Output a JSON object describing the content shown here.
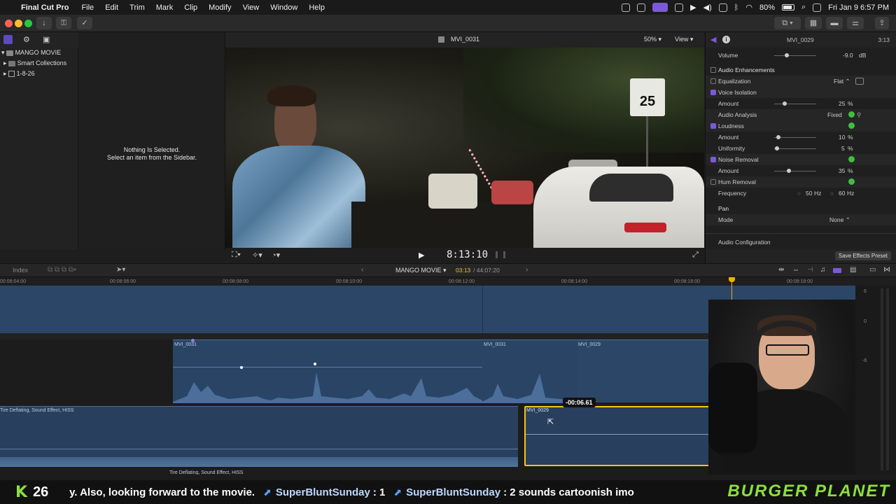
{
  "menubar": {
    "app_name": "Final Cut Pro",
    "items": [
      "File",
      "Edit",
      "Trim",
      "Mark",
      "Clip",
      "Modify",
      "View",
      "Window",
      "Help"
    ],
    "battery": "80%",
    "datetime": "Fri Jan 9  6:57 PM"
  },
  "sidebar": {
    "library": "MANGO MOVIE",
    "items": [
      "Smart Collections",
      "1-8-26"
    ]
  },
  "browser": {
    "empty_line1": "Nothing Is Selected.",
    "empty_line2": "Select an item from the Sidebar."
  },
  "viewer": {
    "clip_name": "MVI_0031",
    "zoom": "50%",
    "view_label": "View",
    "timecode": "8:13:10",
    "sign_text": "25"
  },
  "inspector": {
    "clip_name": "MVI_0029",
    "duration": "3:13",
    "volume_label": "Volume",
    "volume_value": "-9.0",
    "volume_unit": "dB",
    "enhancements_label": "Audio Enhancements",
    "equalization_label": "Equalization",
    "equalization_value": "Flat",
    "voice_isolation_label": "Voice Isolation",
    "amount_label": "Amount",
    "vi_amount": "25",
    "percent": "%",
    "analysis_label": "Audio Analysis",
    "analysis_value": "Fixed",
    "loudness_label": "Loudness",
    "loud_amount": "10",
    "uniformity_label": "Uniformity",
    "uniformity_value": "5",
    "noise_label": "Noise Removal",
    "noise_amount": "35",
    "hum_label": "Hum Removal",
    "frequency_label": "Frequency",
    "freq_50": "50",
    "freq_60": "60",
    "hz": "Hz",
    "pan_label": "Pan",
    "mode_label": "Mode",
    "mode_value": "None",
    "config_label": "Audio Configuration",
    "save_preset": "Save Effects Preset"
  },
  "timeline_bar": {
    "index_label": "Index",
    "project": "MANGO MOVIE",
    "position": "03:13",
    "total": "44:07:20"
  },
  "ruler": [
    "00:08:04:00",
    "00:08:06:00",
    "00:08:08:00",
    "00:08:10:00",
    "00:08:12:00",
    "00:08:14:00",
    "00:08:16:00",
    "00:08:18:00"
  ],
  "clips": {
    "clip_a": "MVI_0031",
    "clip_b": "MVI_0031",
    "clip_c": "MVI_0029",
    "sfx_top": "Tire Deflating, Sound Effect, HISS",
    "sfx_bottom": "Tire Deflating, Sound Effect, HISS",
    "selected": "MVI_0029",
    "offset": "-00:06.61"
  },
  "meter_labels": [
    "6",
    "0",
    "-6"
  ],
  "ticker": {
    "count": "26",
    "text1": "y. Also, looking forward to the movie.",
    "user1": "SuperBluntSunday",
    "msg1": ": 1",
    "user2": "SuperBluntSunday",
    "msg2": ": 2 sounds cartoonish imo",
    "brand": "BURGER PLANET"
  },
  "colors": {
    "accent": "#7a5ad9",
    "clip_blue": "#2c4668",
    "selected_outline": "#f5c518",
    "ticker_green": "#8be03c"
  }
}
